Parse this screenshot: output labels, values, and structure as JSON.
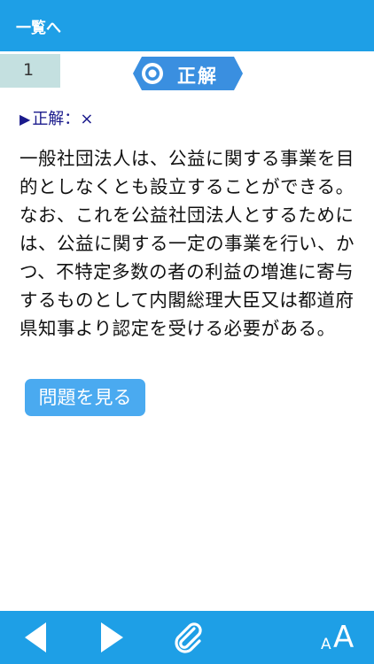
{
  "header": {
    "back_label": "一覧へ"
  },
  "question": {
    "number": "1",
    "result_badge": "正解"
  },
  "answer": {
    "label": "正解：",
    "value": "×"
  },
  "explanation": "一般社団法人は、公益に関する事業を目的としなくとも設立することができる。なお、これを公益社団法人とするためには、公益に関する一定の事業を行い、かつ、不特定多数の者の利益の増進に寄与するものとして内閣総理大臣又は都道府県知事より認定を受ける必要がある。",
  "actions": {
    "show_question_label": "問題を見る"
  },
  "toolbar": {
    "prev_icon": "triangle-left-icon",
    "next_icon": "triangle-right-icon",
    "attach_icon": "paperclip-icon",
    "font_small": "A",
    "font_large": "A"
  },
  "colors": {
    "bar": "#1e9fe6",
    "badge": "#3a8fe0",
    "button": "#4aaaf0",
    "number_bg": "#c4e0e0",
    "answer_text": "#1a1a8c"
  }
}
